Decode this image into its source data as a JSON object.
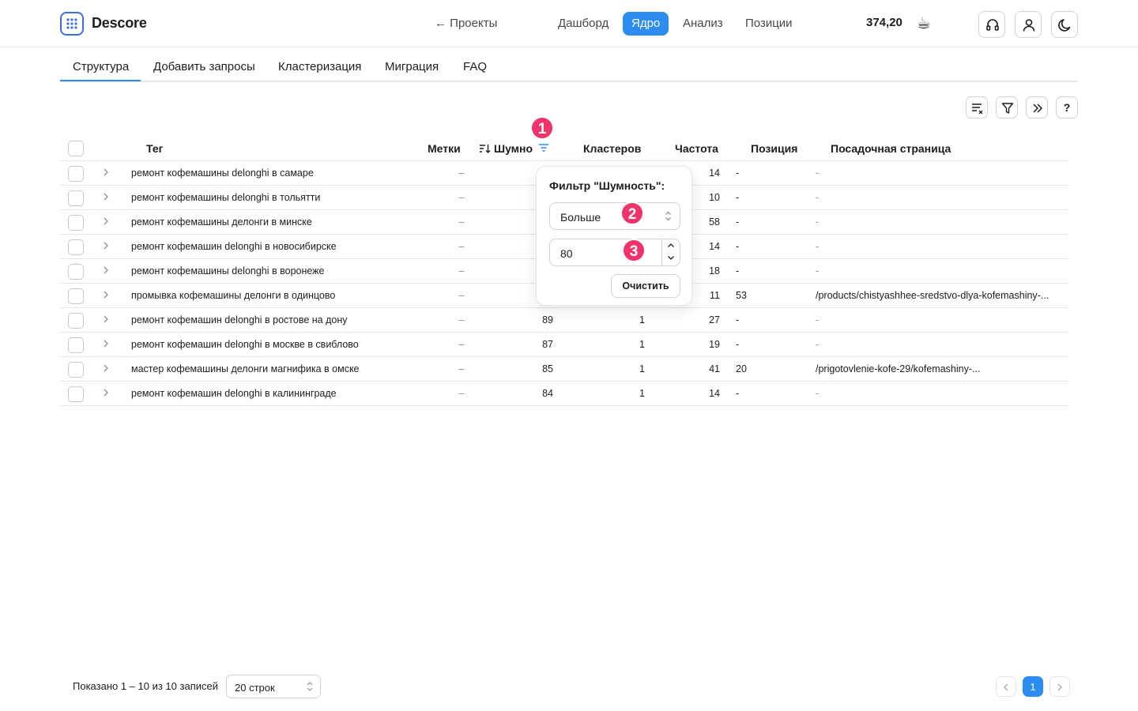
{
  "header": {
    "brand": "Descore",
    "back_link": "← Проекты",
    "nav": [
      {
        "label": "Дашборд",
        "active": false
      },
      {
        "label": "Ядро",
        "active": true
      },
      {
        "label": "Анализ",
        "active": false
      },
      {
        "label": "Позиции",
        "active": false
      }
    ],
    "balance": "374,20",
    "balance_icon": "☕",
    "buttons": [
      "headset-icon",
      "user-icon",
      "moon-icon"
    ]
  },
  "tabs": [
    "Структура",
    "Добавить запросы",
    "Кластеризация",
    "Миграция",
    "FAQ"
  ],
  "active_tab": "Структура",
  "toolbar": {
    "help_label": "?"
  },
  "table": {
    "columns": {
      "tag": "Тег",
      "marks": "Метки",
      "noise": "Шумно",
      "clusters": "Кластеров",
      "frequency": "Частота",
      "position": "Позиция",
      "landing": "Посадочная страница"
    },
    "rows": [
      {
        "tag": "ремонт кофемашины delonghi в самаре",
        "marks": "–",
        "noise": "",
        "clusters": "",
        "freq": "14",
        "pos": "-",
        "page": "-"
      },
      {
        "tag": "ремонт кофемашины delonghi в тольятти",
        "marks": "–",
        "noise": "",
        "clusters": "",
        "freq": "10",
        "pos": "-",
        "page": "-"
      },
      {
        "tag": "ремонт кофемашины делонги в минске",
        "marks": "–",
        "noise": "",
        "clusters": "",
        "freq": "58",
        "pos": "-",
        "page": "-"
      },
      {
        "tag": "ремонт кофемашин delonghi в новосибирске",
        "marks": "–",
        "noise": "",
        "clusters": "",
        "freq": "14",
        "pos": "-",
        "page": "-"
      },
      {
        "tag": "ремонт кофемашины delonghi в воронеже",
        "marks": "–",
        "noise": "",
        "clusters": "",
        "freq": "18",
        "pos": "-",
        "page": "-"
      },
      {
        "tag": "промывка кофемашины делонги в одинцово",
        "marks": "–",
        "noise": "",
        "clusters": "",
        "freq": "11",
        "pos": "53",
        "page": "/products/chistyashhee-sredstvo-dlya-kofemashiny-..."
      },
      {
        "tag": "ремонт кофемашин delonghi в ростове на дону",
        "marks": "–",
        "noise": "89",
        "clusters": "1",
        "freq": "27",
        "pos": "-",
        "page": "-"
      },
      {
        "tag": "ремонт кофемашин delonghi в москве в свиблово",
        "marks": "–",
        "noise": "87",
        "clusters": "1",
        "freq": "19",
        "pos": "-",
        "page": "-"
      },
      {
        "tag": "мастер кофемашины делонги магнифика в омске",
        "marks": "–",
        "noise": "85",
        "clusters": "1",
        "freq": "41",
        "pos": "20",
        "page": "/prigotovlenie-kofe-29/kofemashiny-..."
      },
      {
        "tag": "ремонт кофемашин delonghi в калининграде",
        "marks": "–",
        "noise": "84",
        "clusters": "1",
        "freq": "14",
        "pos": "-",
        "page": "-"
      }
    ]
  },
  "filter_popover": {
    "title": "Фильтр \"Шумность\":",
    "condition": "Больше",
    "value": "80",
    "clear_label": "Очистить"
  },
  "annotations": [
    "1",
    "2",
    "3"
  ],
  "footer": {
    "shown_text": "Показано 1 – 10 из 10 записей",
    "rows_per_page": "20 строк",
    "current_page": "1"
  },
  "colors": {
    "accent": "#2d8cf0",
    "badge": "#f0346a",
    "logo": "#3b6fd9"
  }
}
